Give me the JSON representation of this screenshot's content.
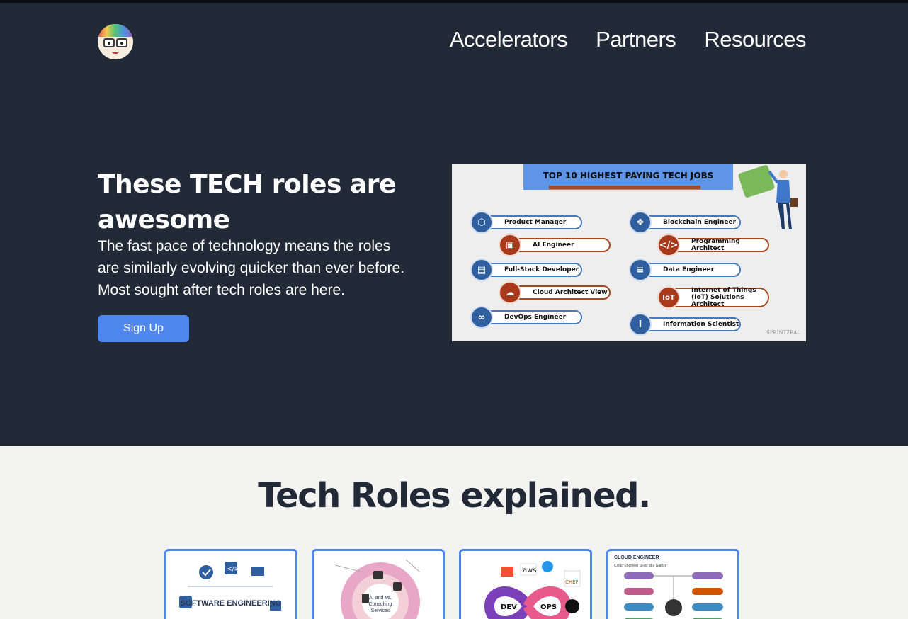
{
  "nav": {
    "items": [
      "Accelerators",
      "Partners",
      "Resources"
    ]
  },
  "hero": {
    "title": "These TECH roles are awesome",
    "text": "The fast pace of technology means the roles are similarly evolving quicker than ever before. Most sought after tech roles are here.",
    "signup_label": "Sign Up"
  },
  "infographic": {
    "title": "TOP 10 HIGHEST PAYING TECH JOBS",
    "items": [
      {
        "label": "Product Manager",
        "icon": "box-icon",
        "color": "#2f5f9f"
      },
      {
        "label": "AI Engineer",
        "icon": "computer-icon",
        "color": "#a8391a"
      },
      {
        "label": "Full-Stack Developer",
        "icon": "window-icon",
        "color": "#2f5f9f"
      },
      {
        "label": "Cloud Architect View",
        "icon": "cloud-upload-icon",
        "color": "#a8391a"
      },
      {
        "label": "DevOps Engineer",
        "icon": "infinity-icon",
        "color": "#2f5f9f"
      },
      {
        "label": "Blockchain Engineer",
        "icon": "cubes-icon",
        "color": "#2f5f9f"
      },
      {
        "label": "Programming Architect",
        "icon": "code-icon",
        "color": "#a8391a"
      },
      {
        "label": "Data Engineer",
        "icon": "database-icon",
        "color": "#2f5f9f"
      },
      {
        "label": "Internet of Things (IoT) Solutions Architect",
        "icon": "iot-icon",
        "color": "#a8391a"
      },
      {
        "label": "Information Scientist",
        "icon": "info-icon",
        "color": "#2f5f9f"
      }
    ],
    "brand": "SPRINTZEAL"
  },
  "section": {
    "title": "Tech Roles explained."
  },
  "cards": [
    {
      "label": "SOFTWARE ENGINEERING",
      "image": "software-engineering-diagram"
    },
    {
      "label": "AI and ML Consulting Services",
      "image": "ai-ml-diagram"
    },
    {
      "label": "DEV OPS",
      "image": "devops-diagram"
    },
    {
      "label": "CLOUD ENGINEER",
      "sublabel": "Cloud Engineer Skills at a Glance",
      "image": "cloud-engineer-diagram"
    }
  ],
  "colors": {
    "hero_bg": "#222937",
    "page_bg": "#f3f3f1",
    "accent": "#4f86ef",
    "title_dark": "#222937"
  }
}
